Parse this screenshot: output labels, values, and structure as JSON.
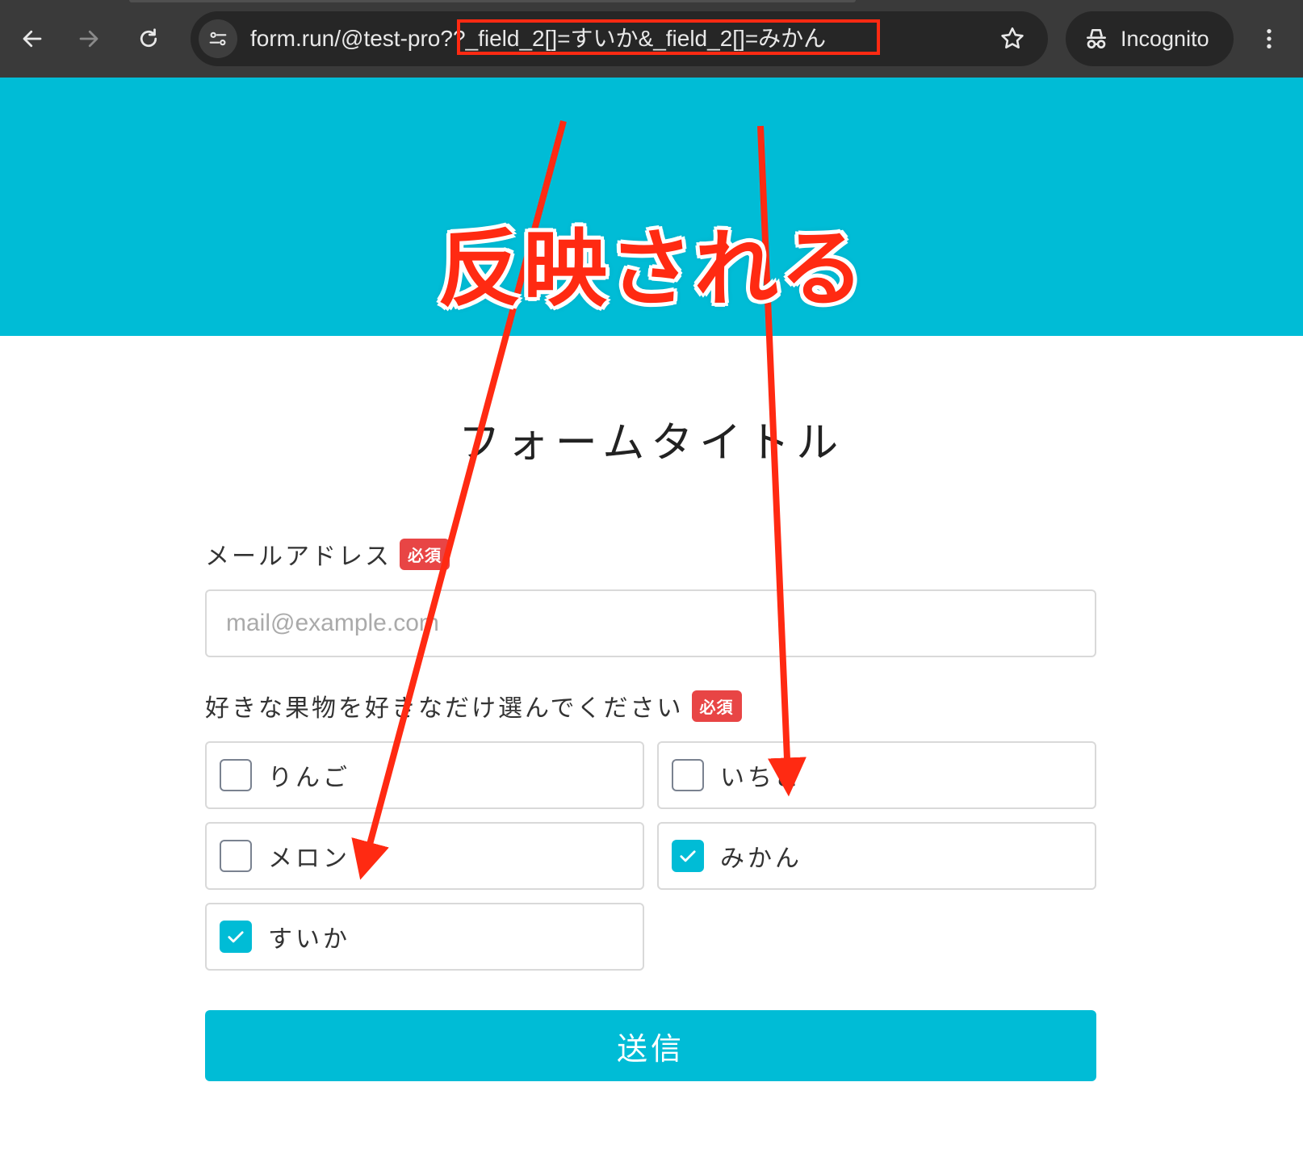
{
  "browser": {
    "url": "form.run/@test-pro??_field_2[]=すいか&_field_2[]=みかん",
    "incognito_label": "Incognito"
  },
  "annotation": {
    "text": "反映される",
    "color": "#ff2a12"
  },
  "form": {
    "title": "フォームタイトル",
    "email_label": "メールアドレス",
    "email_required": "必須",
    "email_placeholder": "mail@example.com",
    "fruit_label": "好きな果物を好きなだけ選んでください",
    "fruit_required": "必須",
    "options": [
      {
        "label": "りんご",
        "checked": false
      },
      {
        "label": "いちご",
        "checked": false
      },
      {
        "label": "メロン",
        "checked": false
      },
      {
        "label": "みかん",
        "checked": true
      },
      {
        "label": "すいか",
        "checked": true
      }
    ],
    "submit_label": "送信"
  },
  "colors": {
    "accent": "#00bcd6",
    "required_badge": "#e84545",
    "chrome": "#3a3a3a"
  }
}
